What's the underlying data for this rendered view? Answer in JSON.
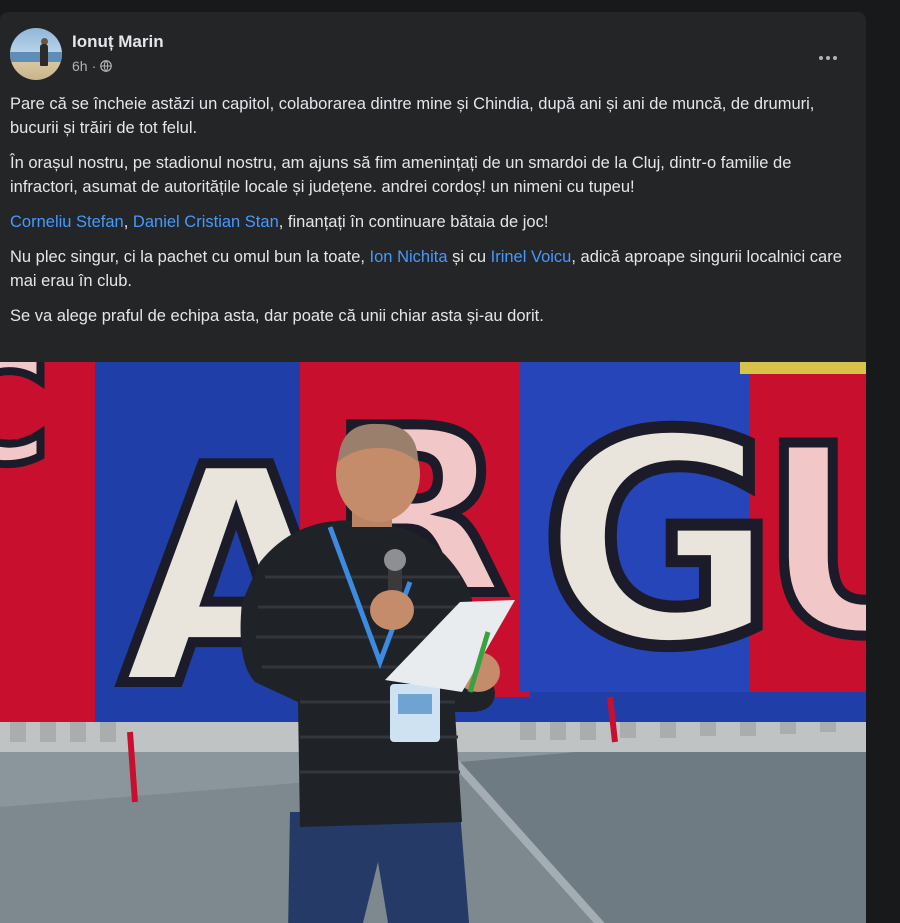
{
  "post": {
    "author": "Ionuț Marin",
    "time": "6h",
    "separator": "·",
    "p1": "Pare că se încheie astăzi un capitol, colaborarea dintre mine și Chindia, după ani și ani de muncă, de drumuri, bucurii și trăiri de tot felul.",
    "p2": "În orașul nostru, pe stadionul nostru, am ajuns să fim amenințați de un smardoi de la Cluj, dintr-o familie de infractori, asumat de autoritățile locale și județene. andrei cordoș! un nimeni cu tupeu!",
    "p3": {
      "link1": "Corneliu Stefan",
      "sep": ", ",
      "link2": "Daniel Cristian Stan",
      "rest": ", finanțați în continuare bătaia de joc!"
    },
    "p4": {
      "start": "Nu plec singur, ci la pachet cu omul bun la toate, ",
      "link1": "Ion Nichita",
      "mid": " și cu ",
      "link2": "Irinel Voicu",
      "rest": ", adică aproape singurii localnici care mai erau în club."
    },
    "p5": "Se va alege praful de echipa asta, dar poate că unii chiar asta și-au dorit.",
    "banner_letters": [
      "A",
      "R",
      "G",
      "U"
    ]
  },
  "colors": {
    "background": "#18191a",
    "card": "#242526",
    "text": "#e4e6eb",
    "secondary": "#b0b3b8",
    "link": "#4599ff",
    "banner_red": "#c8102e",
    "banner_blue": "#1f3ea8"
  },
  "icons": {
    "audience": "globe-icon",
    "menu": "more-dots-icon"
  }
}
